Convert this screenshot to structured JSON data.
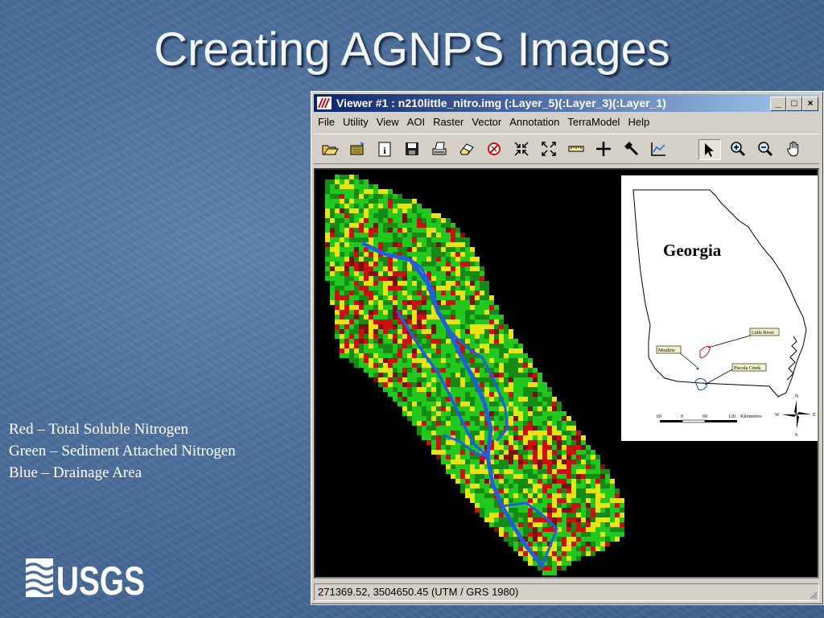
{
  "slide": {
    "title": "Creating AGNPS Images",
    "legend": [
      "Red – Total Soluble Nitrogen",
      "Green – Sediment Attached Nitrogen",
      "Blue – Drainage Area"
    ],
    "logo_text": "USGS"
  },
  "window": {
    "title": "Viewer #1 : n210little_nitro.img (:Layer_5)(:Layer_3)(:Layer_1)",
    "controls": {
      "minimize": "_",
      "maximize": "□",
      "close": "×"
    },
    "menu": [
      "File",
      "Utility",
      "View",
      "AOI",
      "Raster",
      "Vector",
      "Annotation",
      "TerraModel",
      "Help"
    ],
    "toolbar": [
      {
        "name": "open-icon"
      },
      {
        "name": "open-layer-icon"
      },
      {
        "name": "info-icon"
      },
      {
        "name": "save-icon"
      },
      {
        "name": "print-icon"
      },
      {
        "name": "eraser-icon"
      },
      {
        "name": "no-icon"
      },
      {
        "name": "zoom-in-arrows-icon"
      },
      {
        "name": "fit-arrows-icon"
      },
      {
        "name": "ruler-icon"
      },
      {
        "name": "crosshair-icon"
      },
      {
        "name": "hammer-icon"
      },
      {
        "name": "profile-chart-icon"
      },
      {
        "name": "pointer-icon",
        "active": true
      },
      {
        "name": "zoom-in-icon"
      },
      {
        "name": "zoom-out-icon"
      },
      {
        "name": "pan-hand-icon"
      }
    ],
    "status": "271369.52, 3504650.45   (UTM / GRS 1980)"
  },
  "inset": {
    "state_label": "Georgia",
    "labels": {
      "little_river": "Little River",
      "moultrie": "Moultrie",
      "piscola_creek": "Piscola Creek",
      "scale_0": "60",
      "scale_1": "0",
      "scale_2": "60",
      "scale_3": "120",
      "scale_unit": "Kilometers",
      "north": "N",
      "south": "S",
      "east": "E",
      "west": "W"
    }
  },
  "colors": {
    "red_nitrogen": "#cc1010",
    "green_nitrogen": "#22c81e",
    "yellow_mix": "#e8e412",
    "blue_drainage": "#1f5fe0"
  }
}
